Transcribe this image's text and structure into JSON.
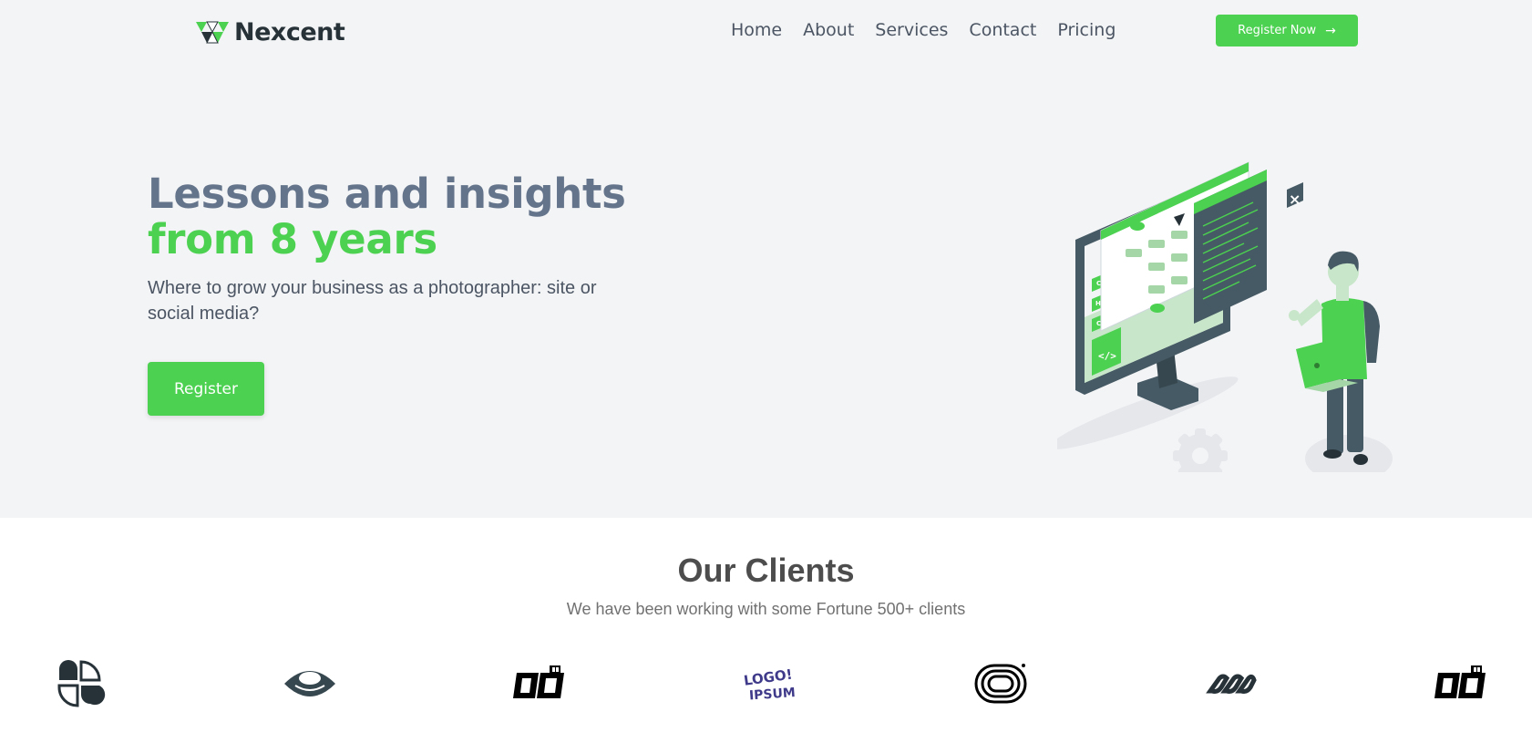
{
  "brand": {
    "name": "Nexcent",
    "logo_icon": "nexcent-logo-icon"
  },
  "nav": {
    "items": [
      {
        "label": "Home"
      },
      {
        "label": "About"
      },
      {
        "label": "Services"
      },
      {
        "label": "Contact"
      },
      {
        "label": "Pricing"
      }
    ],
    "cta_label": "Register Now",
    "cta_icon": "arrow-right-icon"
  },
  "hero": {
    "title_line1": "Lessons and insights",
    "title_line2": "from 8 years",
    "subtitle": "Where to grow your business as a photographer: site or social media?",
    "button_label": "Register",
    "illustration": "developer-with-laptop-illustration",
    "code_badges": [
      "CSS",
      "HTML",
      "C++"
    ]
  },
  "clients": {
    "title": "Our Clients",
    "subtitle": "We have been working with some Fortune 500+ clients",
    "logos": [
      {
        "name": "client-logo-quarters"
      },
      {
        "name": "client-logo-eye"
      },
      {
        "name": "client-logo-blocks"
      },
      {
        "name": "client-logo-ipsum",
        "text_top": "LOGO!",
        "text_bottom": "IPSUM"
      },
      {
        "name": "client-logo-loop"
      },
      {
        "name": "client-logo-infinity"
      },
      {
        "name": "client-logo-blocks"
      }
    ]
  },
  "colors": {
    "accent": "#4cd150",
    "title_gray": "#64748b",
    "background": "#f3f4f6",
    "dark": "#263238"
  }
}
